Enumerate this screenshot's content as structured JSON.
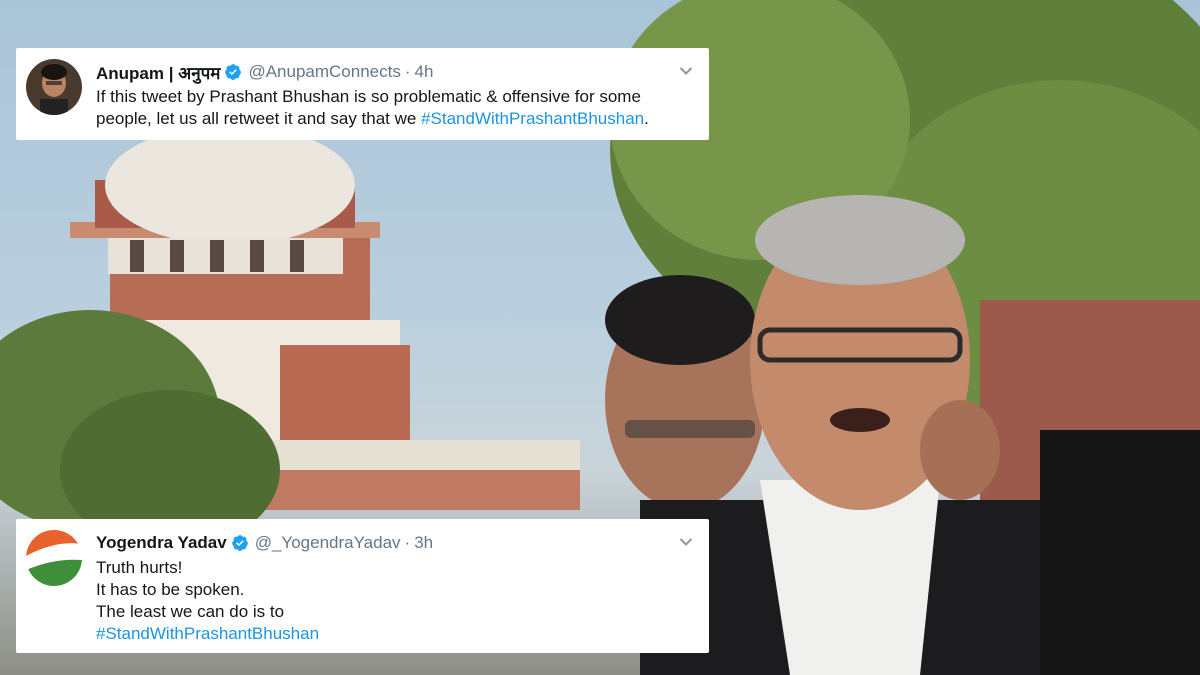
{
  "tweets": [
    {
      "name": "Anupam | अनुपम",
      "handle": "@AnupamConnects",
      "separator": "·",
      "time": "4h",
      "text_line1": "If this tweet by Prashant Bhushan is so problematic & offensive for some",
      "text_line2_prefix": "people, let us all retweet it and say that we ",
      "hashtag": "#StandWithPrashantBhushan",
      "text_line2_suffix": ".",
      "avatar_icon": "profile-photo-icon",
      "verified_icon": "verified-badge-icon"
    },
    {
      "name": "Yogendra Yadav",
      "handle": "@_YogendraYadav",
      "separator": "·",
      "time": "3h",
      "lines": [
        "Truth hurts!",
        "It has to be spoken.",
        "The least we can do is to"
      ],
      "hashtag": "#StandWithPrashantBhushan",
      "avatar_icon": "tricolor-avatar-icon",
      "verified_icon": "verified-badge-icon"
    }
  ],
  "colors": {
    "hashtag": "#1b95e0",
    "verified": "#1da1f2",
    "text": "#14171a",
    "meta": "#657786"
  }
}
